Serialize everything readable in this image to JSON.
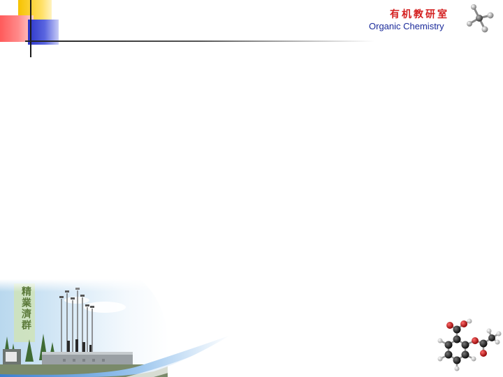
{
  "header": {
    "title_cn": "有机教研室",
    "title_en": "Organic Chemistry"
  },
  "campus_image": {
    "caption": "精業濟群"
  },
  "icons": {
    "top_right": "molecule-icon",
    "bottom_right": "molecule-structure-icon"
  },
  "colors": {
    "title_cn": "#d42020",
    "title_en": "#1a2a9a"
  }
}
